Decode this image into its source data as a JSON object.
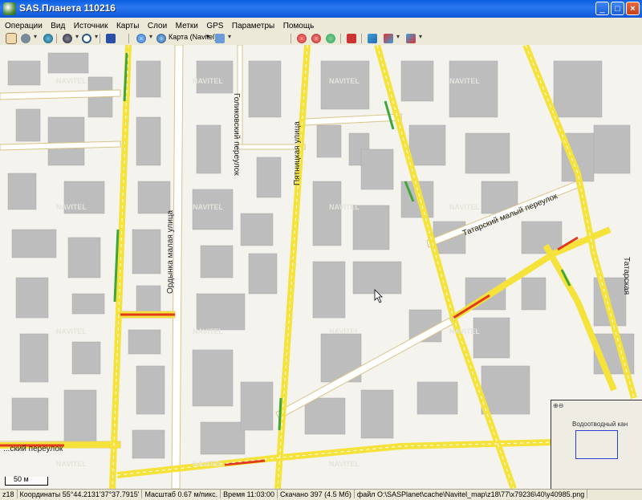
{
  "window": {
    "title": "SAS.Планета 110216",
    "min": "_",
    "max": "□",
    "close": "×"
  },
  "menu": [
    "Операции",
    "Вид",
    "Источник",
    "Карты",
    "Слои",
    "Метки",
    "GPS",
    "Параметры",
    "Помощь"
  ],
  "toolbar": {
    "map_selector": "Карта (Navitel)"
  },
  "map": {
    "streets": {
      "s1": "Голиковский переулок",
      "s2": "Пятницкая улица",
      "s3": "Ордынка малая улица",
      "s4": "Татарский малый переулок",
      "s5": "Татарская",
      "s6": "...ский переулок"
    },
    "watermark": "NAVITEL",
    "scale_label": "50 м",
    "minimap_street": "Водоотводный кан"
  },
  "status": {
    "zoom": "z18",
    "coords": "Координаты 55°44.2131'37°37.7915'",
    "scale": "Масштаб 0.67 м/пикс.",
    "time": "Время 11:03:00",
    "downloaded": "Скачано 397 (4.5 Мб)",
    "file": "файл O:\\SASPlanet\\cache\\Navitel_map\\z18\\77\\x79236\\40\\y40985.png"
  },
  "colors": {
    "traffic_yellow": "#f5e23a",
    "traffic_red": "#e23a1f",
    "traffic_green": "#3fa63a",
    "building": "#bdbdbd",
    "road": "#ffffff",
    "road_edge": "#d8c48a"
  }
}
